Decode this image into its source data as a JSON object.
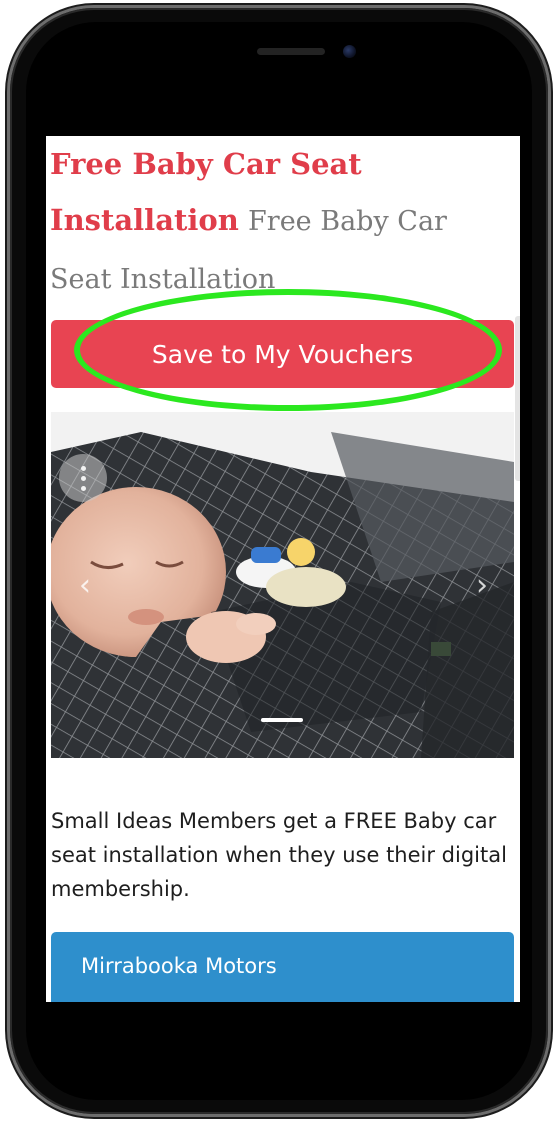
{
  "deal": {
    "title": "Free Baby Car Seat Installation",
    "subtitle": "Free Baby Car Seat Installation",
    "save_button_label": "Save to My Vouchers",
    "description": "Small Ideas Members get a FREE Baby car seat installation when they use their digital membership.",
    "merchant_name": "Mirrabooka Motors"
  },
  "carousel": {
    "prev_icon": "chevron-left-icon",
    "next_icon": "chevron-right-icon",
    "menu_icon": "vertical-dots-icon"
  },
  "colors": {
    "title_red": "#e03d4a",
    "button_red": "#e84452",
    "highlight_green": "#2be81f",
    "merchant_blue": "#2e8fcc"
  }
}
